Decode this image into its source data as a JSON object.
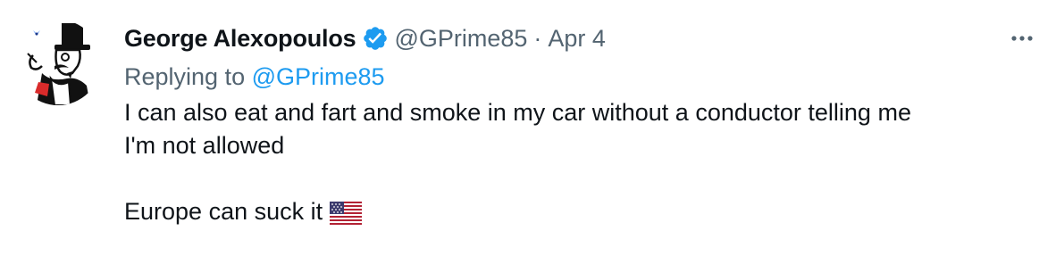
{
  "tweet": {
    "author": {
      "display_name": "George Alexopoulos",
      "handle": "@GPrime85",
      "verified": true,
      "verified_color": "#1d9bf0",
      "avatar_icon": "monocle-top-hat-man-icon"
    },
    "separator": "·",
    "date": "Apr 4",
    "more_icon": "more-options-icon",
    "reply": {
      "prefix": "Replying to ",
      "handle": "@GPrime85"
    },
    "text": {
      "line1": "I can also eat and fart and smoke in my car without a conductor telling me",
      "line2": "I'm not allowed",
      "line3": "Europe can suck it",
      "emoji": "us-flag-emoji"
    }
  }
}
